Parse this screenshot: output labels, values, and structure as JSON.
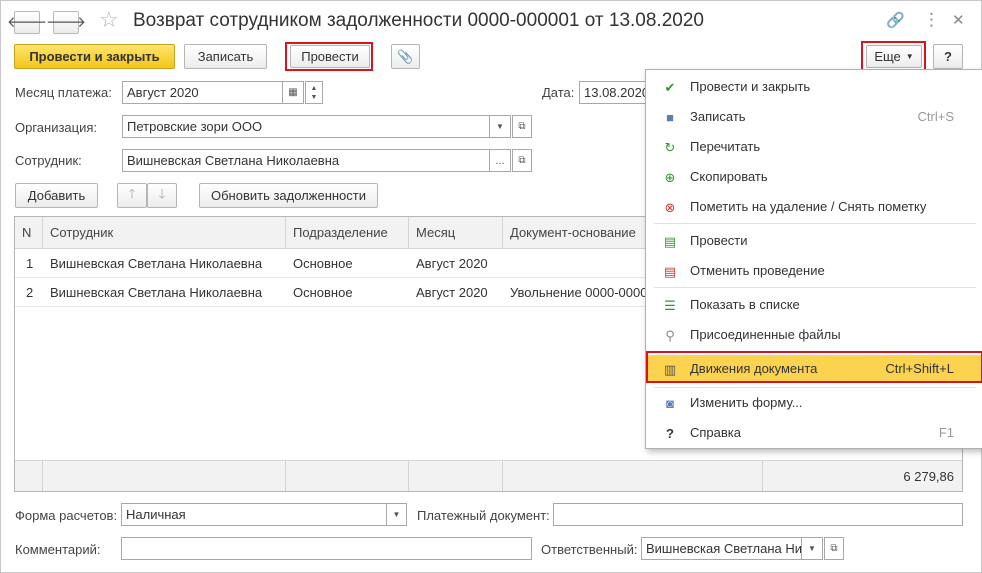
{
  "window": {
    "title": "Возврат сотрудником задолженности 0000-000001 от 13.08.2020",
    "back_glyph": "🡐",
    "forward_glyph": "🡒",
    "star_glyph": "☆",
    "link_glyph": "🔗",
    "more_glyph": "⋮",
    "close_glyph": "✕"
  },
  "toolbar": {
    "post_close_label": "Провести и закрыть",
    "save_label": "Записать",
    "post_label": "Провести",
    "attach_glyph": "📎",
    "more_label": "Еще",
    "help_label": "?"
  },
  "form": {
    "month_label": "Месяц платежа:",
    "month_value": "Август 2020",
    "date_label": "Дата:",
    "date_value": "13.08.2020",
    "org_label": "Организация:",
    "org_value": "Петровские зори ООО",
    "employee_label": "Сотрудник:",
    "employee_value": "Вишневская Светлана Николаевна"
  },
  "table_toolbar": {
    "add_label": "Добавить",
    "refresh_label": "Обновить задолженности"
  },
  "table": {
    "columns": [
      "N",
      "Сотрудник",
      "Подразделение",
      "Месяц",
      "Документ-основание"
    ],
    "rows": [
      [
        "1",
        "Вишневская Светлана Николаевна",
        "Основное",
        "Август 2020",
        ""
      ],
      [
        "2",
        "Вишневская Светлана Николаевна",
        "Основное",
        "Август 2020",
        "Увольнение 0000-00000"
      ]
    ],
    "total": "6 279,86"
  },
  "footer": {
    "payment_form_label": "Форма расчетов:",
    "payment_form_value": "Наличная",
    "payment_doc_label": "Платежный документ:",
    "payment_doc_value": "",
    "comment_label": "Комментарий:",
    "comment_value": "",
    "responsible_label": "Ответственный:",
    "responsible_value": "Вишневская Светлана Ни"
  },
  "menu": {
    "items": [
      {
        "label": "Провести и закрыть",
        "shortcut": "",
        "icon": "post-close-icon",
        "glyph": "✔",
        "color": "#2e9a2e"
      },
      {
        "label": "Записать",
        "shortcut": "Ctrl+S",
        "icon": "save-icon",
        "glyph": "■",
        "color": "#5a7fb5"
      },
      {
        "label": "Перечитать",
        "shortcut": "",
        "icon": "reload-icon",
        "glyph": "↻",
        "color": "#2e9a2e"
      },
      {
        "label": "Скопировать",
        "shortcut": "",
        "icon": "copy-icon",
        "glyph": "⊕",
        "color": "#2e9a2e"
      },
      {
        "label": "Пометить на удаление / Снять пометку",
        "shortcut": "",
        "icon": "mark-delete-icon",
        "glyph": "⊗",
        "color": "#d23a2a"
      },
      {
        "label": "Провести",
        "shortcut": "",
        "icon": "post-icon",
        "glyph": "▤",
        "color": "#2e9a2e"
      },
      {
        "label": "Отменить проведение",
        "shortcut": "",
        "icon": "unpost-icon",
        "glyph": "▤",
        "color": "#d23a2a"
      },
      {
        "label": "Показать в списке",
        "shortcut": "",
        "icon": "show-in-list-icon",
        "glyph": "☰",
        "color": "#2e9a2e"
      },
      {
        "label": "Присоединенные файлы",
        "shortcut": "",
        "icon": "attachment-icon",
        "glyph": "⚲",
        "color": "#888888"
      },
      {
        "label": "Движения документа",
        "shortcut": "Ctrl+Shift+L",
        "icon": "document-movements-icon",
        "glyph": "▥",
        "color": "#555555"
      },
      {
        "label": "Изменить форму...",
        "shortcut": "",
        "icon": "change-form-icon",
        "glyph": "◙",
        "color": "#5a7fb5"
      },
      {
        "label": "Справка",
        "shortcut": "F1",
        "icon": "help-icon",
        "glyph": "?",
        "color": "#333333"
      }
    ]
  },
  "colors": {
    "accent_yellow": "#f4c51a",
    "highlight": "#fbd34f",
    "annotation_red": "#d8141e"
  }
}
